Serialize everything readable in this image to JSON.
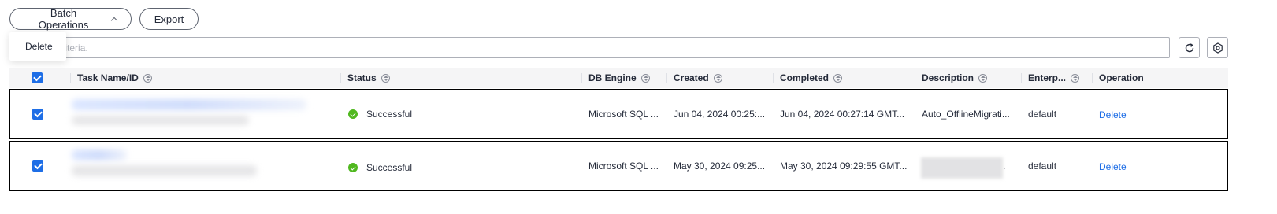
{
  "toolbar": {
    "batch_label": "Batch  Operations",
    "export_label": "Export"
  },
  "dropdown": {
    "delete_label": "Delete"
  },
  "search": {
    "placeholder": "Search criteria."
  },
  "table": {
    "headers": {
      "name": "Task Name/ID",
      "status": "Status",
      "engine": "DB Engine",
      "created": "Created",
      "completed": "Completed",
      "description": "Description",
      "enterprise": "Enterp...",
      "operation": "Operation"
    },
    "rows": [
      {
        "status": "Successful",
        "engine": "Microsoft SQL ...",
        "created": "Jun 04, 2024 00:25:...",
        "completed": "Jun 04, 2024 00:27:14 GMT...",
        "description": "Auto_OfflineMigrati...",
        "enterprise": "default",
        "operation": "Delete"
      },
      {
        "status": "Successful",
        "engine": "Microsoft SQL ...",
        "created": "May 30, 2024 09:25...",
        "completed": "May 30, 2024 09:29:55 GMT...",
        "description_suffix": ".",
        "enterprise": "default",
        "operation": "Delete"
      }
    ]
  },
  "colors": {
    "accent": "#1e6ee6",
    "success": "#50b81f"
  }
}
